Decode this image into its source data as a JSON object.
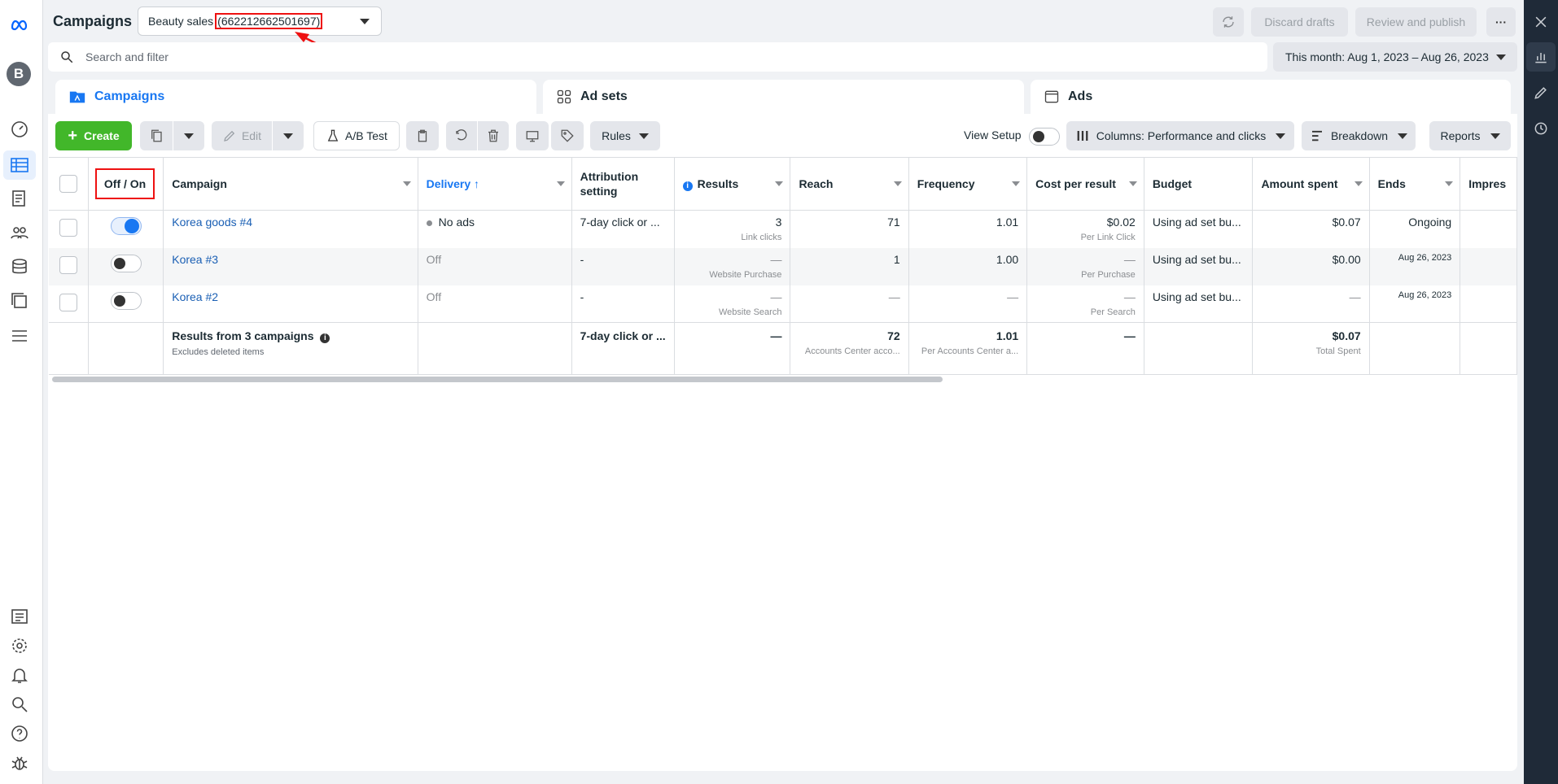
{
  "app": {
    "title": "Campaigns"
  },
  "account": {
    "name": "Beauty sales",
    "id": "(662212662501697)"
  },
  "avatar": {
    "letter": "B"
  },
  "topbar": {
    "discard_label": "Discard drafts",
    "review_label": "Review and publish",
    "more_label": "···"
  },
  "search": {
    "placeholder": "Search and filter"
  },
  "daterange": {
    "label": "This month: Aug 1, 2023 – Aug 26, 2023"
  },
  "tabs": [
    {
      "label": "Campaigns",
      "active": true
    },
    {
      "label": "Ad sets",
      "active": false
    },
    {
      "label": "Ads",
      "active": false
    }
  ],
  "toolbar": {
    "create_label": "Create",
    "edit_label": "Edit",
    "abtest_label": "A/B Test",
    "rules_label": "Rules",
    "viewsetup_label": "View Setup",
    "columns_label": "Columns: Performance and clicks",
    "breakdown_label": "Breakdown",
    "reports_label": "Reports"
  },
  "table": {
    "headers": {
      "toggle": "Off / On",
      "campaign": "Campaign",
      "delivery": "Delivery",
      "attribution_line1": "Attribution",
      "attribution_line2": "setting",
      "results": "Results",
      "reach": "Reach",
      "frequency": "Frequency",
      "cost": "Cost per result",
      "budget": "Budget",
      "spent": "Amount spent",
      "ends": "Ends",
      "impressions": "Impres"
    },
    "rows": [
      {
        "on": true,
        "name": "Korea goods #4",
        "delivery": "No ads",
        "attribution": "7-day click or ...",
        "results": "3",
        "results_sub": "Link clicks",
        "reach": "71",
        "frequency": "1.01",
        "cost": "$0.02",
        "cost_sub": "Per Link Click",
        "budget": "Using ad set bu...",
        "spent": "$0.07",
        "ends": "Ongoing"
      },
      {
        "on": false,
        "name": "Korea #3",
        "delivery": "Off",
        "attribution": "-",
        "results": "—",
        "results_sub": "Website Purchase",
        "reach": "1",
        "frequency": "1.00",
        "cost": "—",
        "cost_sub": "Per Purchase",
        "budget": "Using ad set bu...",
        "spent": "$0.00",
        "ends": "Aug 26, 2023"
      },
      {
        "on": false,
        "name": "Korea #2",
        "delivery": "Off",
        "attribution": "-",
        "results": "—",
        "results_sub": "Website Search",
        "reach": "—",
        "frequency": "—",
        "cost": "—",
        "cost_sub": "Per Search",
        "budget": "Using ad set bu...",
        "spent": "—",
        "ends": "Aug 26, 2023"
      }
    ],
    "totals": {
      "label": "Results from 3 campaigns",
      "sublabel": "Excludes deleted items",
      "attribution": "7-day click or ...",
      "results": "—",
      "reach": "72",
      "reach_sub": "Accounts Center acco...",
      "frequency": "1.01",
      "frequency_sub": "Per Accounts Center a...",
      "cost": "—",
      "spent": "$0.07",
      "spent_sub": "Total Spent"
    }
  },
  "colors": {
    "accent": "#1877f2",
    "create": "#42b72a",
    "annotation": "#e11111"
  },
  "icons": [
    "meta-logo-icon",
    "dashboard-icon",
    "table-icon",
    "pages-icon",
    "audience-icon",
    "stack-icon",
    "catalog-icon",
    "menu-icon",
    "news-icon",
    "gear-icon",
    "bell-icon",
    "search-icon",
    "help-icon",
    "bug-icon",
    "chart-icon",
    "pencil-icon",
    "clock-icon",
    "close-icon"
  ]
}
